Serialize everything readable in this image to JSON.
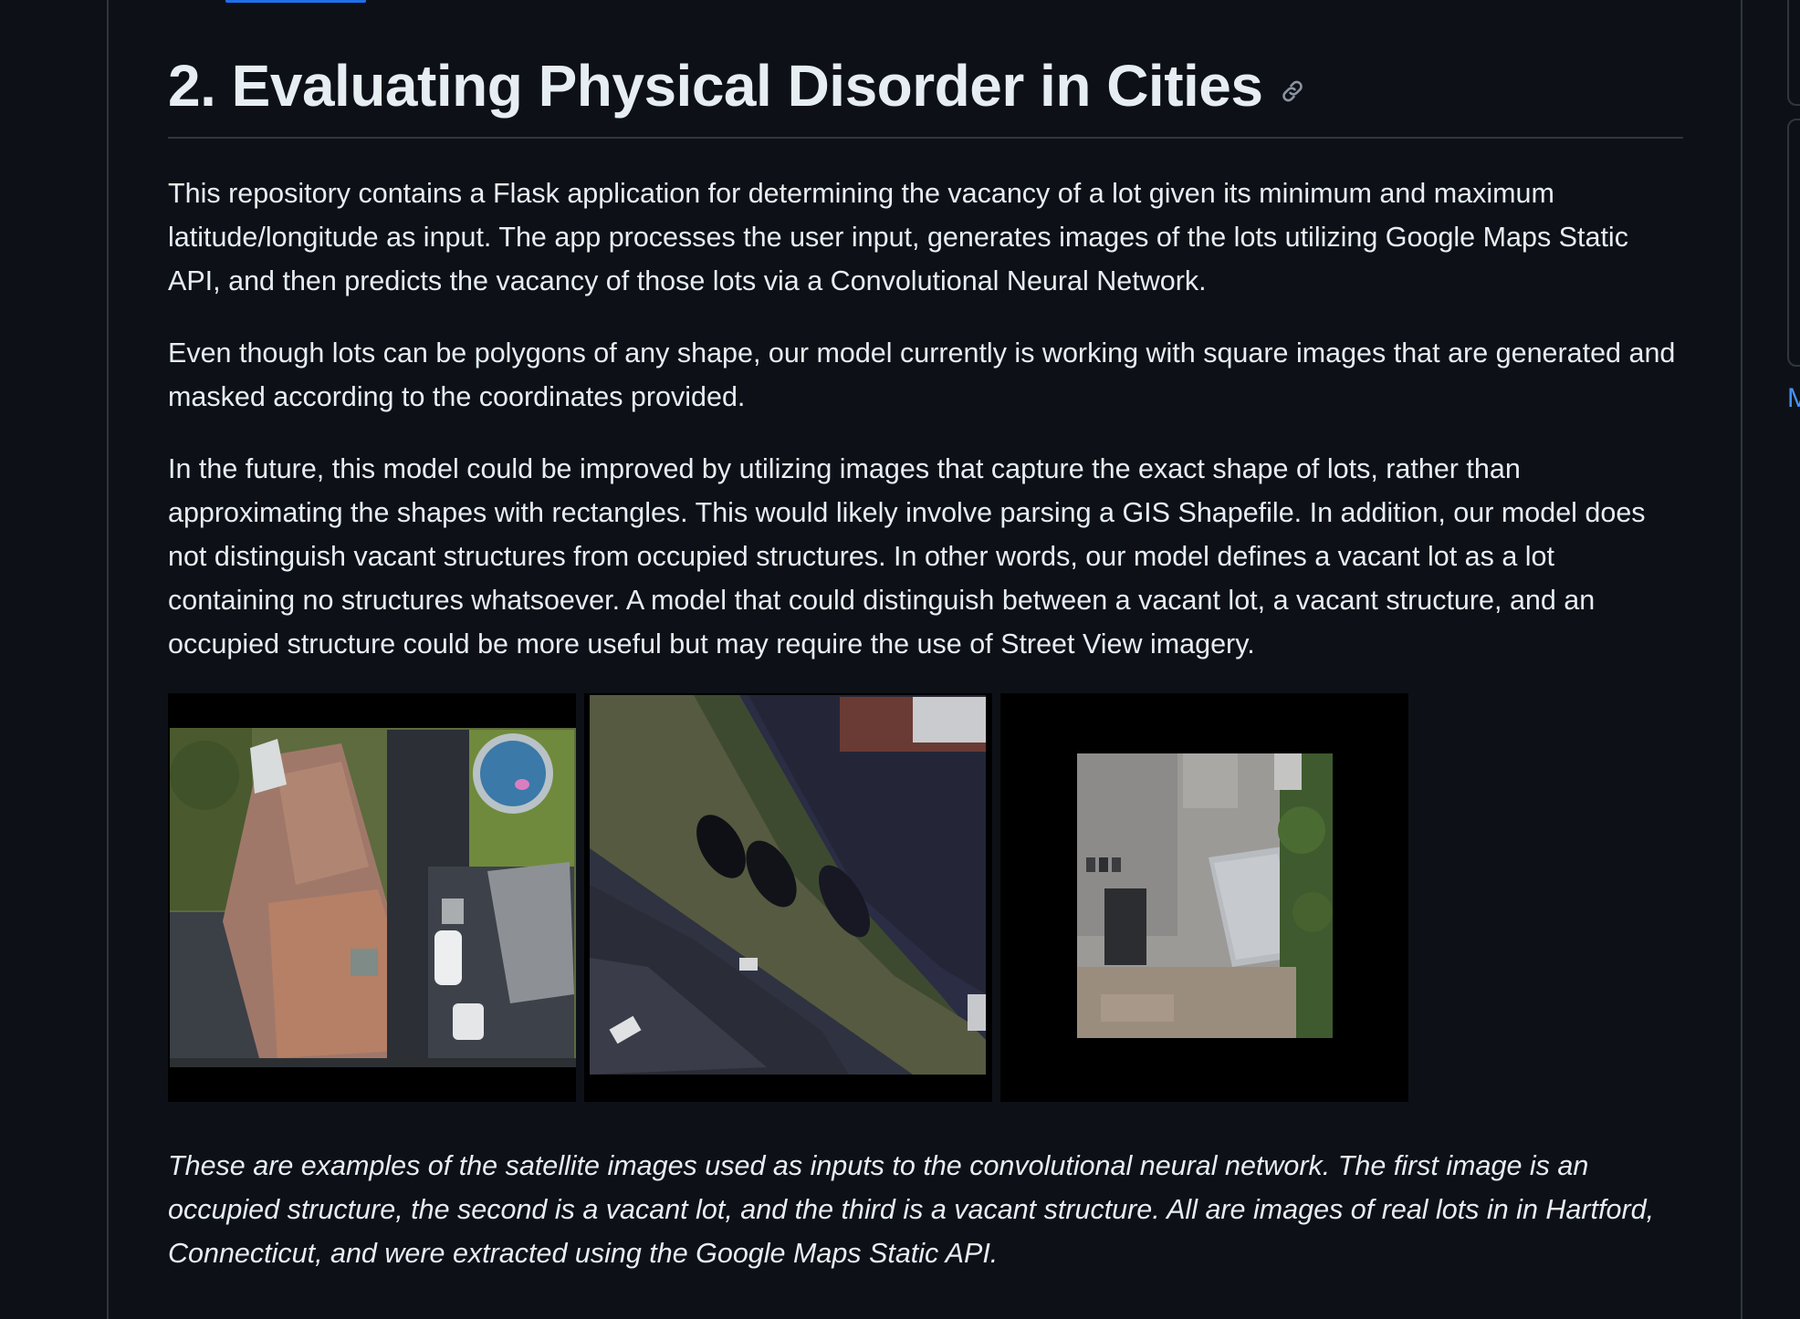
{
  "section": {
    "heading": "2. Evaluating Physical Disorder in Cities",
    "anchor_icon": "link-icon"
  },
  "paragraphs": {
    "p1": "This repository contains a Flask application for determining the vacancy of a lot given its minimum and maximum latitude/longitude as input. The app processes the user input, generates images of the lots utilizing Google Maps Static API, and then predicts the vacancy of those lots via a Convolutional Neural Network.",
    "p2": "Even though lots can be polygons of any shape, our model currently is working with square images that are generated and masked according to the coordinates provided.",
    "p3": "In the future, this model could be improved by utilizing images that capture the exact shape of lots, rather than approximating the shapes with rectangles. This would likely involve parsing a GIS Shapefile. In addition, our model does not distinguish vacant structures from occupied structures. In other words, our model defines a vacant lot as a lot containing no structures whatsoever. A model that could distinguish between a vacant lot, a vacant structure, and an occupied structure could be more useful but may require the use of Street View imagery."
  },
  "images": [
    {
      "subject": "occupied structure"
    },
    {
      "subject": "vacant lot"
    },
    {
      "subject": "vacant structure"
    }
  ],
  "caption": "These are examples of the satellite images used as inputs to the convolutional neural network. The first image is an occupied structure, the second is a vacant lot, and the third is a vacant structure. All are images of real lots in in Hartford, Connecticut, and were extracted using the Google Maps Static API.",
  "sidebar": {
    "partial_link": "M"
  },
  "colors": {
    "background": "#0d1117",
    "text": "#e6edf3",
    "border": "#30363d",
    "accent": "#1f6feb",
    "link": "#4493f8"
  }
}
